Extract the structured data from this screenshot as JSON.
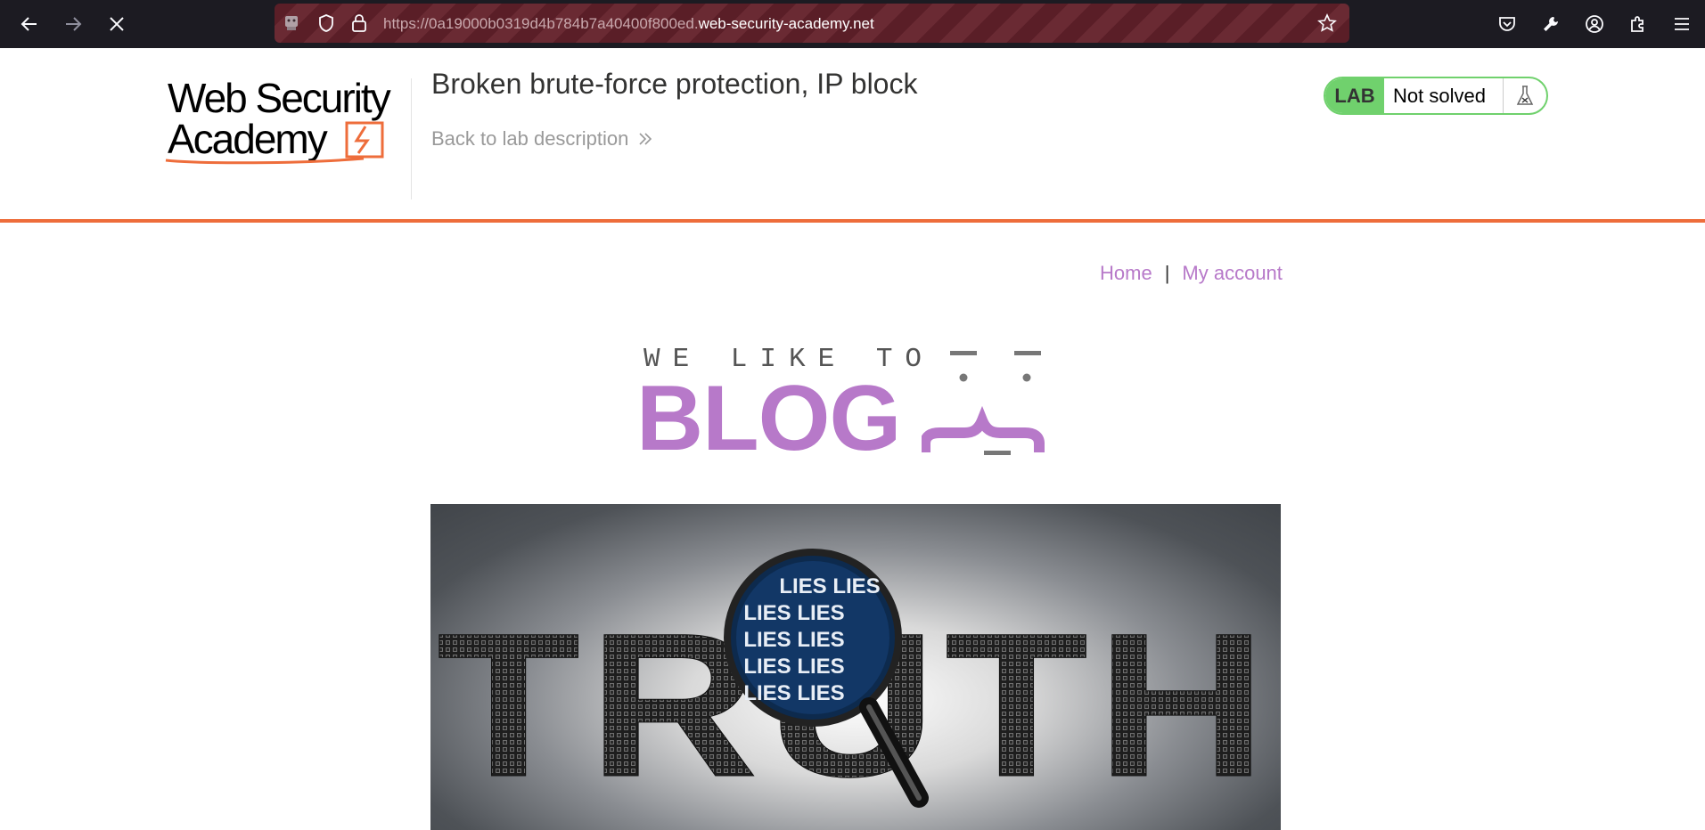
{
  "browser": {
    "url_prefix": "https://0a19000b0319d4b784b7a40400f800ed.",
    "url_domain": "web-security-academy.net"
  },
  "lab_header": {
    "logo_line1": "Web Security",
    "logo_line2": "Academy",
    "title": "Broken brute-force protection, IP block",
    "back_link": "Back to lab description",
    "badge": "LAB",
    "status": "Not solved"
  },
  "nav": {
    "home": "Home",
    "separator": "|",
    "account": "My account"
  },
  "blog_logo": {
    "tagline": "WE LIKE TO",
    "word": "BLOG"
  },
  "hero_image": {
    "big_word": "TRUTH",
    "lens_word": "LIES"
  },
  "colors": {
    "accent_orange": "#ee6d3b",
    "link_purple": "#b779c9",
    "lab_green": "#70d16d",
    "toolbar_bg": "#1c1b22"
  }
}
